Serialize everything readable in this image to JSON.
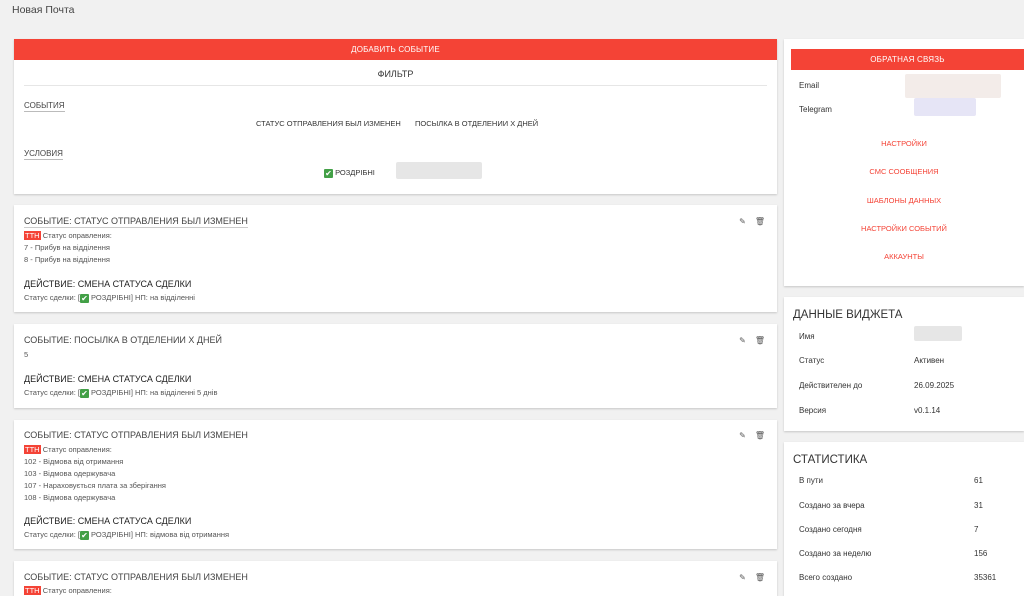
{
  "app": {
    "title": "Новая Почта"
  },
  "main": {
    "add_event_label": "ДОБАВИТЬ СОБЫТИЕ",
    "filter": {
      "title": "ФИЛЬТР",
      "events_label": "СОБЫТИЯ",
      "event_types": [
        "СТАТУС ОТПРАВЛЕНИЯ БЫЛ ИЗМЕНЕН",
        "ПОСЫЛКА В ОТДЕЛЕНИИ X ДНЕЙ"
      ],
      "conditions_label": "УСЛОВИЯ",
      "condition_value": "РОЗДРІБНІ"
    },
    "events": [
      {
        "title": "СОБЫТИЕ: СТАТУС ОТПРАВЛЕНИЯ БЫЛ ИЗМЕНЕН",
        "badge": "ТТН",
        "status_label": "Статус оправления:",
        "lines": [
          "7 - Прибув на відділення",
          "8 - Прибув на відділення"
        ],
        "action_title": "ДЕЙСТВИЕ: СМЕНА СТАТУСА СДЕЛКИ",
        "deal_prefix": "Статус сделки: [",
        "deal_pipeline": "РОЗДРІБНІ] НП: на відділенні"
      },
      {
        "title": "СОБЫТИЕ: ПОСЫЛКА В ОТДЕЛЕНИИ X ДНЕЙ",
        "days": "5",
        "action_title": "ДЕЙСТВИЕ: СМЕНА СТАТУСА СДЕЛКИ",
        "deal_prefix": "Статус сделки: [",
        "deal_pipeline": "РОЗДРІБНІ] НП: на відділенні 5 днів"
      },
      {
        "title": "СОБЫТИЕ: СТАТУС ОТПРАВЛЕНИЯ БЫЛ ИЗМЕНЕН",
        "badge": "ТТН",
        "status_label": "Статус оправления:",
        "lines": [
          "102 - Відмова від отримання",
          "103 - Відмова одержувача",
          "107 - Нараховується плата за зберігання",
          "108 - Відмова одержувача"
        ],
        "action_title": "ДЕЙСТВИЕ: СМЕНА СТАТУСА СДЕЛКИ",
        "deal_prefix": "Статус сделки: [",
        "deal_pipeline": "РОЗДРІБНІ] НП: відмова від отримання"
      },
      {
        "title": "СОБЫТИЕ: СТАТУС ОТПРАВЛЕНИЯ БЫЛ ИЗМЕНЕН",
        "badge": "ТТН",
        "status_label": "Статус оправления:"
      }
    ]
  },
  "sidebar": {
    "feedback_label": "ОБРАТНАЯ СВЯЗЬ",
    "email_label": "Email",
    "telegram_label": "Telegram",
    "links": [
      "НАСТРОЙКИ",
      "СМС СООБЩЕНИЯ",
      "ШАБЛОНЫ ДАННЫХ",
      "НАСТРОЙКИ СОБЫТИЙ",
      "АККАУНТЫ"
    ],
    "widget": {
      "title": "ДАННЫЕ ВИДЖЕТА",
      "rows": [
        {
          "k": "Имя",
          "v": ""
        },
        {
          "k": "Статус",
          "v": "Активен"
        },
        {
          "k": "Действителен до",
          "v": "26.09.2025"
        },
        {
          "k": "Версия",
          "v": "v0.1.14"
        }
      ]
    },
    "stats": {
      "title": "СТАТИСТИКА",
      "rows": [
        {
          "k": "В пути",
          "v": "61"
        },
        {
          "k": "Создано за вчера",
          "v": "31"
        },
        {
          "k": "Создано сегодня",
          "v": "7"
        },
        {
          "k": "Создано за неделю",
          "v": "156"
        },
        {
          "k": "Всего создано",
          "v": "35361"
        }
      ]
    }
  },
  "colors": {
    "accent": "#f44336",
    "check": "#43a047"
  },
  "icons": {
    "edit": "pencil-icon",
    "delete": "trash-icon",
    "check": "checkbox-checked-icon"
  }
}
